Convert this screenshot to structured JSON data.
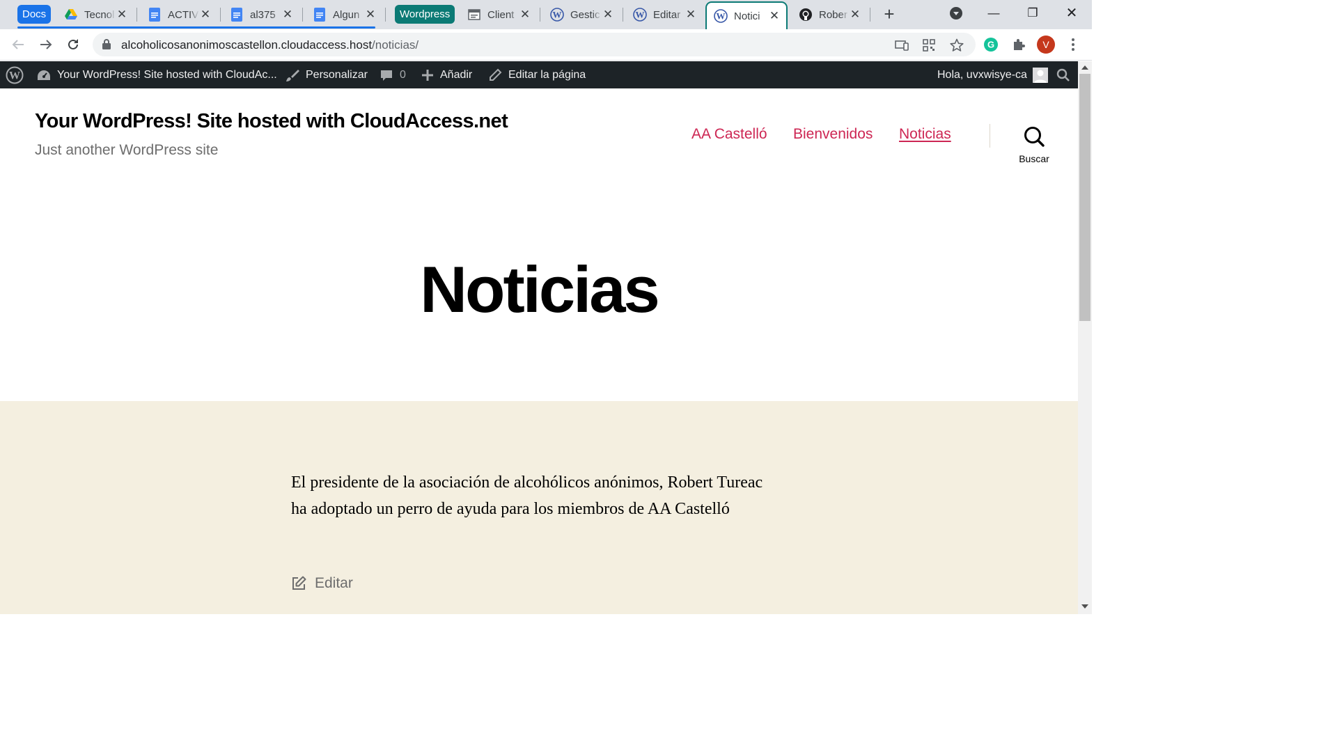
{
  "browser": {
    "tab_groups": [
      {
        "label": "Docs",
        "color": "#1a73e8"
      },
      {
        "label": "Wordpress",
        "color": "#0b7a75"
      }
    ],
    "tabs": [
      {
        "title": "Tecnol",
        "icon": "google-drive-icon"
      },
      {
        "title": "ACTIV",
        "icon": "google-docs-icon"
      },
      {
        "title": "al375",
        "icon": "google-docs-icon"
      },
      {
        "title": "Algun",
        "icon": "google-docs-icon"
      },
      {
        "title": "Client",
        "icon": "document-icon"
      },
      {
        "title": "Gestic",
        "icon": "wordpress-icon"
      },
      {
        "title": "Editar",
        "icon": "wordpress-icon"
      },
      {
        "title": "Notici",
        "icon": "wordpress-icon",
        "active": true
      },
      {
        "title": "Rober",
        "icon": "github-icon"
      }
    ],
    "url": {
      "host": "alcoholicosanonimoscastellon.cloudaccess.host",
      "path": "/noticias/"
    },
    "profile_initial": "V",
    "profile_color": "#c5381c"
  },
  "admin_bar": {
    "site_name": "Your WordPress! Site hosted with CloudAc...",
    "customize": "Personalizar",
    "comments_count": "0",
    "new": "Añadir",
    "edit_page": "Editar la página",
    "greeting": "Hola, uvxwisye-ca"
  },
  "site": {
    "title": "Your WordPress! Site hosted with CloudAccess.net",
    "description": "Just another WordPress site",
    "menu": [
      {
        "label": "AA Castelló"
      },
      {
        "label": "Bienvenidos"
      },
      {
        "label": "Noticias",
        "current": true
      }
    ],
    "search_label": "Buscar",
    "accent_color": "#cd2653"
  },
  "page": {
    "heading": "Noticias",
    "entry": "El presidente de la asociación de alcohólicos anónimos, Robert Tureac ha adoptado un perro de ayuda para los miembros de AA Castelló",
    "edit_label": "Editar"
  }
}
